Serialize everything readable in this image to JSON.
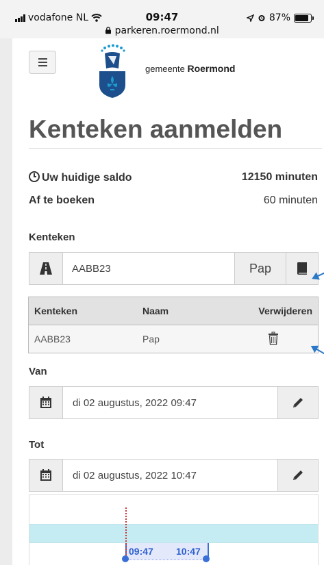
{
  "status_bar": {
    "carrier": "vodafone NL",
    "time": "09:47",
    "battery": "87%",
    "url": "parkeren.roermond.nl"
  },
  "header": {
    "brand_prefix": "gemeente",
    "brand_name": "Roermond"
  },
  "page_title": "Kenteken aanmelden",
  "saldo": {
    "current_label": "Uw huidige saldo",
    "current_value": "12150 minuten",
    "deduct_label": "Af te boeken",
    "deduct_value": "60 minuten"
  },
  "kenteken": {
    "label": "Kenteken",
    "value": "AABB23",
    "name": "Pap"
  },
  "table": {
    "headers": [
      "Kenteken",
      "Naam",
      "Verwijderen"
    ],
    "rows": [
      {
        "kenteken": "AABB23",
        "naam": "Pap"
      }
    ]
  },
  "van": {
    "label": "Van",
    "value": "di 02 augustus, 2022 09:47"
  },
  "tot": {
    "label": "Tot",
    "value": "di 02 augustus, 2022 10:47"
  },
  "timeline": {
    "start": "09:47",
    "end": "10:47"
  },
  "colors": {
    "accent": "#3a6fd8",
    "band": "#c5ecf3",
    "hint_arrow": "#2a78c8"
  }
}
